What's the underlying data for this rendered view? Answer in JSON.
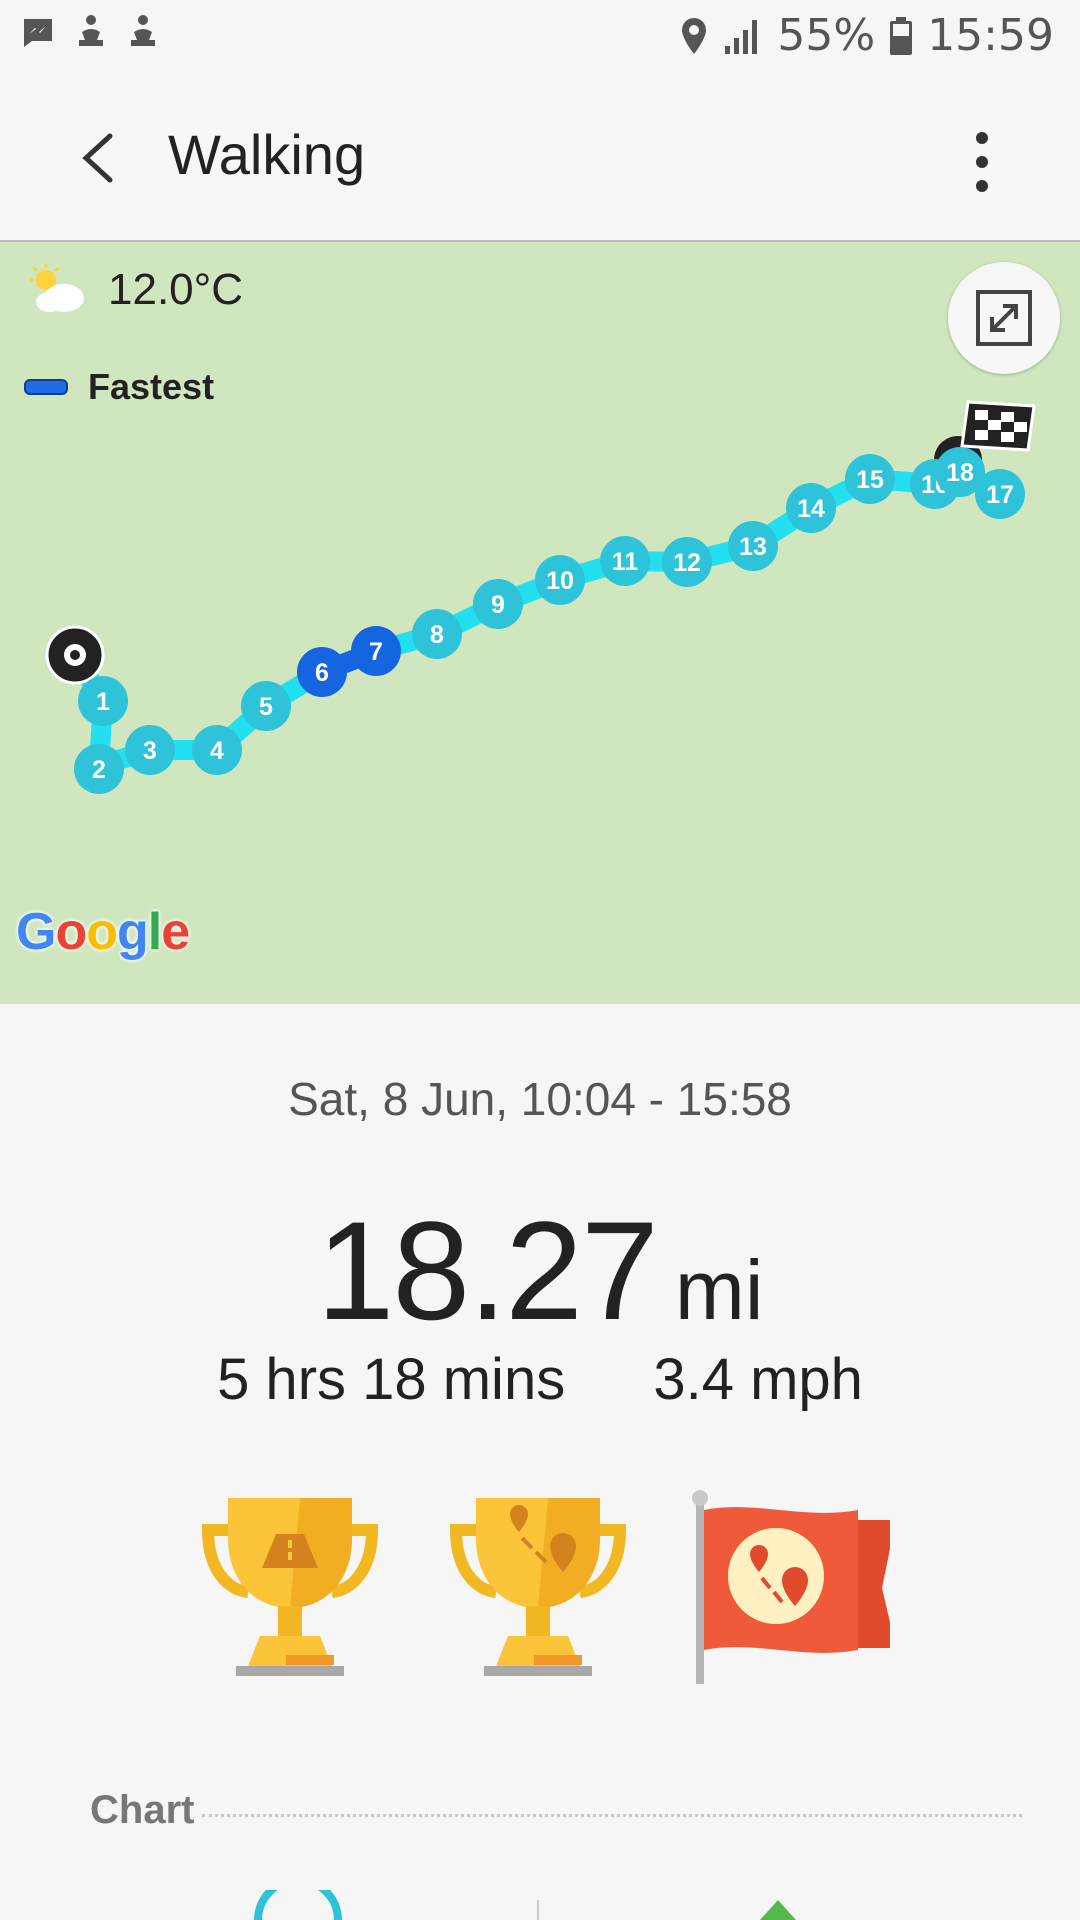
{
  "status_bar": {
    "icons_left": [
      "messenger-icon",
      "fitness-icon",
      "fitness-icon"
    ],
    "battery": "55%",
    "time": "15:59",
    "icons_right": [
      "location-icon",
      "signal-icon",
      "battery-icon"
    ]
  },
  "app_bar": {
    "title": "Walking",
    "back_icon": "back-arrow-icon",
    "menu_icon": "more-vert-icon"
  },
  "map": {
    "temperature": "12.0°C",
    "weather_icon": "partly-sunny-icon",
    "legend_label": "Fastest",
    "legend_color": "#1b6ee8",
    "route_color": "#2ed3e8",
    "marker_color": "#2ec3d9",
    "fastest_marker_color": "#1565e0",
    "fastest_markers": [
      "6",
      "7"
    ],
    "markers": [
      "1",
      "2",
      "3",
      "4",
      "5",
      "6",
      "7",
      "8",
      "9",
      "10",
      "11",
      "12",
      "13",
      "14",
      "15",
      "16",
      "18",
      "17"
    ],
    "attribution": "Google"
  },
  "summary": {
    "date_range": "Sat, 8 Jun, 10:04 - 15:58",
    "distance_value": "18.27",
    "distance_unit": "mi",
    "duration": "5 hrs 18 mins",
    "speed": "3.4 mph"
  },
  "awards": [
    {
      "name": "distance-trophy"
    },
    {
      "name": "route-trophy"
    },
    {
      "name": "route-flag"
    }
  ],
  "chart_section": {
    "label": "Chart"
  }
}
